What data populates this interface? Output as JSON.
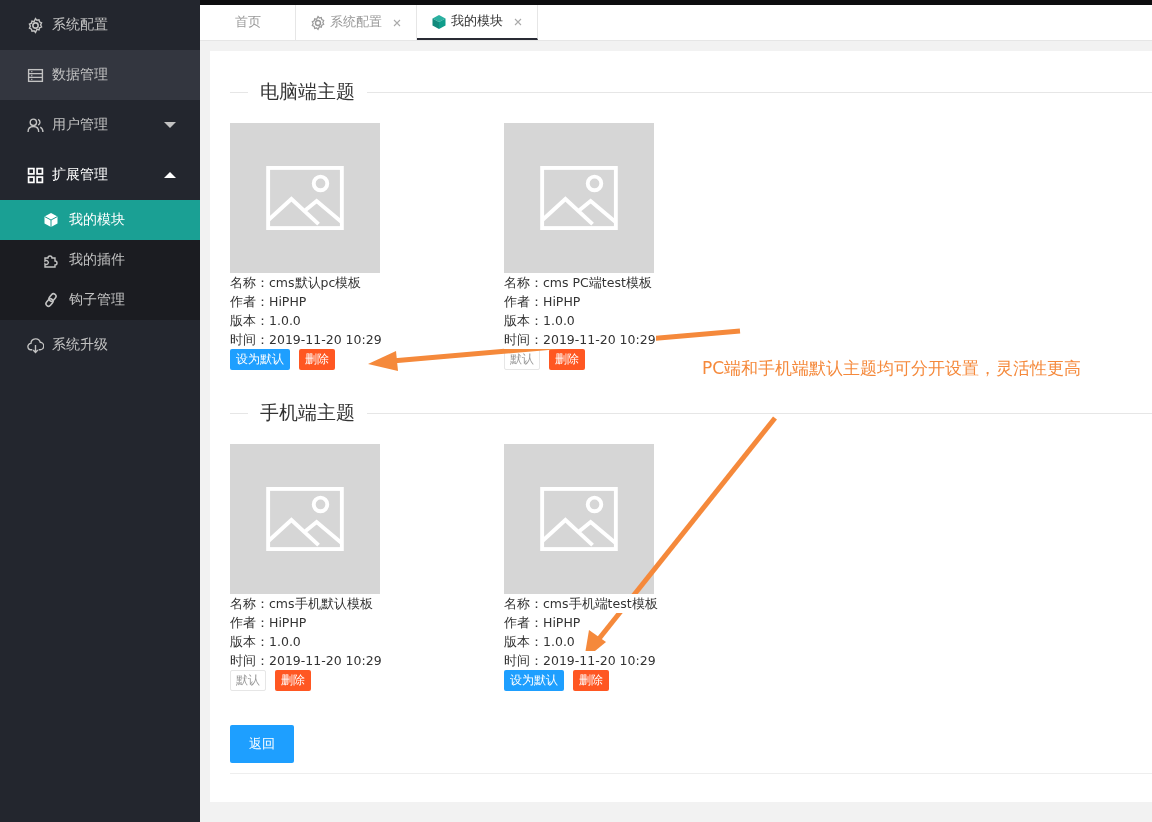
{
  "sidebar": {
    "items": [
      {
        "label": "系统配置",
        "hovered": false
      },
      {
        "label": "数据管理",
        "hovered": true
      },
      {
        "label": "用户管理",
        "hovered": false,
        "expanded": false
      },
      {
        "label": "扩展管理",
        "hovered": false,
        "expanded": true,
        "children": [
          {
            "label": "我的模块",
            "selected": true
          },
          {
            "label": "我的插件",
            "selected": false
          },
          {
            "label": "钩子管理",
            "selected": false
          }
        ]
      },
      {
        "label": "系统升级",
        "hovered": false
      }
    ]
  },
  "tabs": [
    {
      "label": "首页",
      "selected": false,
      "closable": false
    },
    {
      "label": "系统配置",
      "selected": false,
      "closable": true
    },
    {
      "label": "我的模块",
      "selected": true,
      "closable": true
    }
  ],
  "sections": [
    {
      "title": "电脑端主题",
      "themes": [
        {
          "name": "名称：cms默认pc模板",
          "author": "作者：HiPHP",
          "version": "版本：1.0.0",
          "time": "时间：2019-11-20 10:29",
          "is_default": false,
          "default_button": "设为默认",
          "delete_button": "删除"
        },
        {
          "name": "名称：cms PC端test模板",
          "author": "作者：HiPHP",
          "version": "版本：1.0.0",
          "time": "时间：2019-11-20 10:29",
          "is_default": true,
          "default_button": "默认",
          "delete_button": "删除"
        }
      ]
    },
    {
      "title": "手机端主题",
      "themes": [
        {
          "name": "名称：cms手机默认模板",
          "author": "作者：HiPHP",
          "version": "版本：1.0.0",
          "time": "时间：2019-11-20 10:29",
          "is_default": true,
          "default_button": "默认",
          "delete_button": "删除"
        },
        {
          "name": "名称：cms手机端test模板",
          "author": "作者：HiPHP",
          "version": "版本：1.0.0",
          "time": "时间：2019-11-20 10:29",
          "is_default": false,
          "default_button": "设为默认",
          "delete_button": "删除"
        }
      ]
    }
  ],
  "back_button": "返回",
  "annotation": "PC端和手机端默认主题均可分开设置，灵活性更高"
}
